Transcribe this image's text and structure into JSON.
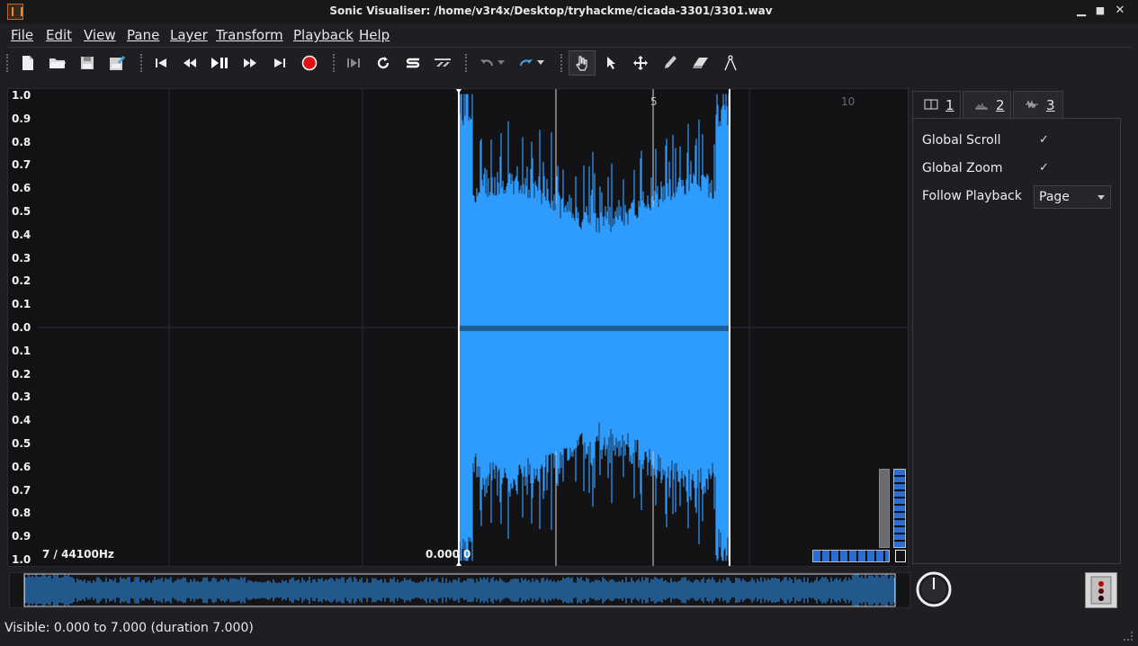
{
  "window": {
    "title": "Sonic Visualiser: /home/v3r4x/Desktop/tryhackme/cicada-3301/3301.wav",
    "minimize": "▁",
    "maximize": "■",
    "close": "✕"
  },
  "menu": [
    {
      "label": "File"
    },
    {
      "label": "Edit"
    },
    {
      "label": "View"
    },
    {
      "label": "Pane"
    },
    {
      "label": "Layer"
    },
    {
      "label": "Transform"
    },
    {
      "label": "Playback"
    },
    {
      "label": "Help"
    }
  ],
  "toolbar": {
    "icons": [
      "new-file-icon",
      "open-file-icon",
      "save-icon",
      "save-session-icon",
      "rewind-start-icon",
      "rewind-icon",
      "play-pause-icon",
      "fast-forward-icon",
      "fast-forward-end-icon",
      "record-icon",
      "constrain-playback-icon",
      "loop-icon",
      "solo-icon",
      "speed-icon",
      "undo-icon",
      "redo-icon",
      "navigate-icon",
      "select-icon",
      "move-icon",
      "draw-icon",
      "erase-icon",
      "measure-icon"
    ]
  },
  "pane": {
    "scale_labels": [
      "1.0",
      "0.9",
      "0.8",
      "0.7",
      "0.6",
      "0.5",
      "0.4",
      "0.3",
      "0.2",
      "0.1",
      "0.0",
      "0.1",
      "0.2",
      "0.3",
      "0.4",
      "0.5",
      "0.6",
      "0.7",
      "0.8",
      "0.9",
      "1.0"
    ],
    "rate_info": "7 / 44100Hz",
    "selection_start": "0.000",
    "selection_zero": "0",
    "ruler_labels": [
      {
        "text": "5",
        "dim": false
      },
      {
        "text": "10",
        "dim": true
      }
    ],
    "waveform_color": "#2f9bff",
    "background": "#131316"
  },
  "properties": {
    "tabs": [
      {
        "label": "1",
        "icon": "pane-icon",
        "active": true
      },
      {
        "label": "2",
        "icon": "spectrum-icon",
        "active": false
      },
      {
        "label": "3",
        "icon": "waveform-icon",
        "active": false
      }
    ],
    "global_scroll_label": "Global Scroll",
    "global_scroll_checked": "✓",
    "global_zoom_label": "Global Zoom",
    "global_zoom_checked": "✓",
    "follow_playback_label": "Follow Playback",
    "follow_playback_value": "Page"
  },
  "status": {
    "text": "Visible: 0.000 to 7.000 (duration 7.000)"
  }
}
